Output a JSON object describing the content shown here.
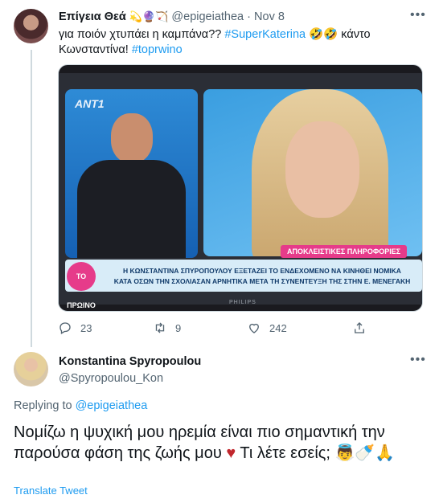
{
  "tweet1": {
    "name": "Επίγεια Θεά",
    "name_emojis": "💫🔮🏹",
    "handle": "@epigeiathea",
    "separator": "·",
    "date": "Nov 8",
    "text_part1": "για ποιόν χτυπάει η καμπάνα?? ",
    "hashtag1": "#SuperKaterina",
    "text_part2": " 🤣🤣 κάντο Κωνσταντίνα! ",
    "hashtag2": "#toprwino",
    "media": {
      "channel_logo": "ANT1",
      "exclusive_label": "ΑΠΟΚΛΕΙΣΤΙΚΕΣ ΠΛΗΡΟΦΟΡΙΕΣ",
      "show_logo": "ΤΟ ΠΡΩΙΝΟ",
      "ticker_line1": "Η ΚΩΝΣΤΑΝΤΙΝΑ ΣΠΥΡΟΠΟΥΛΟΥ ΕΞΕΤΑΖΕΙ ΤΟ ΕΝΔΕΧΟΜΕΝΟ ΝΑ ΚΙΝΗΘΕΙ ΝΟΜΙΚΑ",
      "ticker_line2": "ΚΑΤΑ ΟΣΩΝ ΤΗΝ ΣΧΟΛΙΑΣΑΝ ΑΡΝΗΤΙΚΑ ΜΕΤΑ ΤΗ ΣΥΝΕΝΤΕΥΞΗ ΤΗΣ ΣΤΗΝ Ε. ΜΕΝΕΓΑΚΗ",
      "tv_brand": "PHILIPS"
    },
    "actions": {
      "replies": "23",
      "retweets": "9",
      "likes": "242"
    }
  },
  "tweet2": {
    "name": "Konstantina Spyropoulou",
    "handle": "@Spyropoulou_Kon",
    "replying_prefix": "Replying to ",
    "replying_handle": "@epigeiathea",
    "text_part1": "Νομίζω η ψυχική μου ηρεμία είναι πιο σημαντική την παρούσα φάση της ζωής μου ",
    "heart": "♥",
    "text_part2": " Τι λέτε εσείς; 👼🍼🙏",
    "translate": "Translate Tweet"
  },
  "icons": {
    "more": "more-icon",
    "reply": "reply-icon",
    "retweet": "retweet-icon",
    "like": "like-icon",
    "share": "share-icon"
  },
  "colors": {
    "link": "#1d9bf0",
    "secondary_text": "#536471",
    "primary_text": "#0f1419",
    "heart": "#c1272d"
  }
}
